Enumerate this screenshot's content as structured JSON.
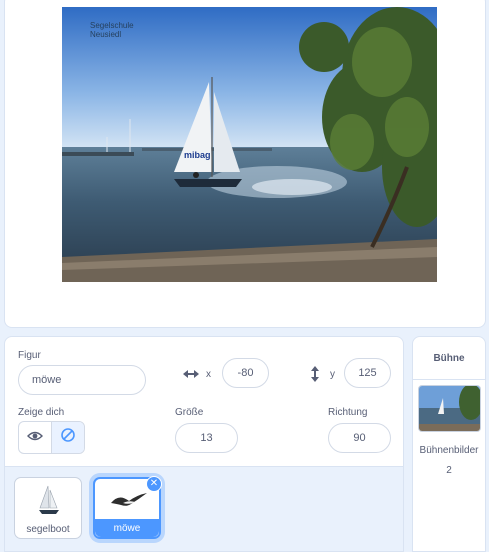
{
  "stage": {
    "watermark_line1": "Segelschule",
    "watermark_line2": "Neusiedl",
    "boat_sail_text": "mibag"
  },
  "sprite_info": {
    "sprite_label": "Figur",
    "sprite_name": "möwe",
    "x_label": "x",
    "x_value": "-80",
    "y_label": "y",
    "y_value": "125",
    "show_label": "Zeige dich",
    "size_label": "Größe",
    "size_value": "13",
    "direction_label": "Richtung",
    "direction_value": "90"
  },
  "sprites": [
    {
      "name": "segelboot",
      "selected": false
    },
    {
      "name": "möwe",
      "selected": true
    }
  ],
  "stage_column": {
    "header": "Bühne",
    "backdrops_label": "Bühnenbilder",
    "backdrops_count": "2"
  },
  "colors": {
    "accent": "#4c97ff",
    "text": "#575e75",
    "panel_bg": "#e9f1fc"
  }
}
